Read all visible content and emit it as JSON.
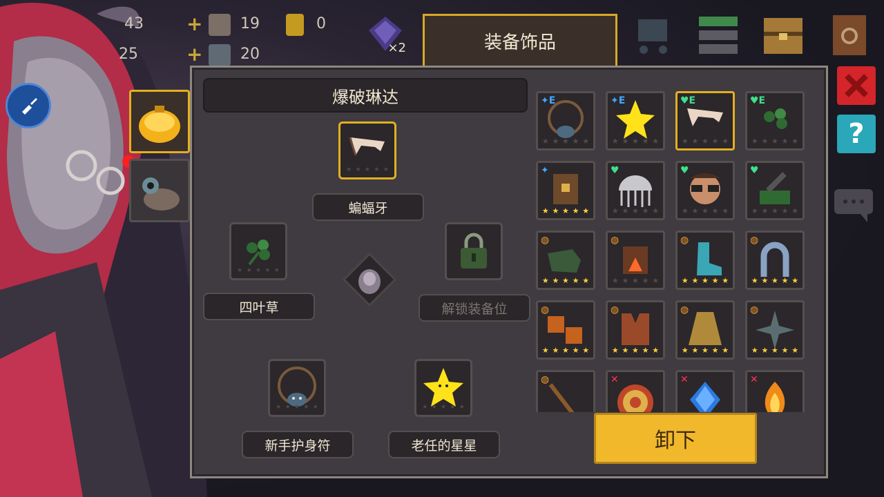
{
  "top_bar": {
    "res_a": "43",
    "res_b": "25",
    "count_1": "19",
    "count_2": "0",
    "count_3": "20",
    "gem_multiplier": "×2"
  },
  "title_tab": "装备饰品",
  "character": {
    "name": "爆破琳达"
  },
  "slots": {
    "top": {
      "label": "蝙蝠牙",
      "icon": "bat-fang-icon"
    },
    "left": {
      "label": "四叶草",
      "icon": "clover-icon"
    },
    "right": {
      "label": "解锁装备位",
      "icon": "lock-icon"
    },
    "bottom_left": {
      "label": "新手护身符",
      "icon": "amulet-icon"
    },
    "bottom_right": {
      "label": "老任的星星",
      "icon": "star-icon"
    }
  },
  "grid_items": [
    {
      "icon": "amulet-icon",
      "tag": "✦E",
      "tag_color": "#3fa7ff",
      "stars": 0
    },
    {
      "icon": "star-icon",
      "tag": "✦E",
      "tag_color": "#3fa7ff",
      "stars": 0
    },
    {
      "icon": "bat-fang-icon",
      "tag": "♥E",
      "tag_color": "#3fe08a",
      "stars": 0,
      "selected": true
    },
    {
      "icon": "clover-icon",
      "tag": "♥E",
      "tag_color": "#3fe08a",
      "stars": 0
    },
    {
      "icon": "backpack-icon",
      "tag": "✦",
      "tag_color": "#3fa7ff",
      "stars": 5
    },
    {
      "icon": "jellyfish-icon",
      "tag": "♥",
      "tag_color": "#3fe08a",
      "stars": 0
    },
    {
      "icon": "glasses-face-icon",
      "tag": "♥",
      "tag_color": "#3fe08a",
      "stars": 0
    },
    {
      "icon": "cannon-icon",
      "tag": "♥",
      "tag_color": "#3fe08a",
      "stars": 0
    },
    {
      "icon": "gauntlet-icon",
      "tag": "◍",
      "tag_color": "#f39a2a",
      "stars": 5
    },
    {
      "icon": "fire-pot-icon",
      "tag": "◍",
      "tag_color": "#f39a2a",
      "stars": 0
    },
    {
      "icon": "boot-icon",
      "tag": "◍",
      "tag_color": "#f39a2a",
      "stars": 5
    },
    {
      "icon": "horseshoe-icon",
      "tag": "◍",
      "tag_color": "#f39a2a",
      "stars": 5
    },
    {
      "icon": "bracers-icon",
      "tag": "◍",
      "tag_color": "#f39a2a",
      "stars": 5
    },
    {
      "icon": "vest-icon",
      "tag": "◍",
      "tag_color": "#f39a2a",
      "stars": 5
    },
    {
      "icon": "cape-icon",
      "tag": "◍",
      "tag_color": "#f39a2a",
      "stars": 5
    },
    {
      "icon": "shuriken-icon",
      "tag": "◍",
      "tag_color": "#f39a2a",
      "stars": 5
    },
    {
      "icon": "staff-icon",
      "tag": "◍",
      "tag_color": "#f39a2a",
      "stars": 0
    },
    {
      "icon": "target-icon",
      "tag": "✕",
      "tag_color": "#ff3355",
      "stars": 0
    },
    {
      "icon": "blue-gem-icon",
      "tag": "✕",
      "tag_color": "#ff3355",
      "stars": 0
    },
    {
      "icon": "flame-crystal-icon",
      "tag": "✕",
      "tag_color": "#ff3355",
      "stars": 0
    }
  ],
  "unload_button": "卸下",
  "colors": {
    "accent_gold": "#e3b020",
    "button_yellow": "#f2b82c",
    "close_red": "#d4252a",
    "help_teal": "#2aa7b8"
  }
}
